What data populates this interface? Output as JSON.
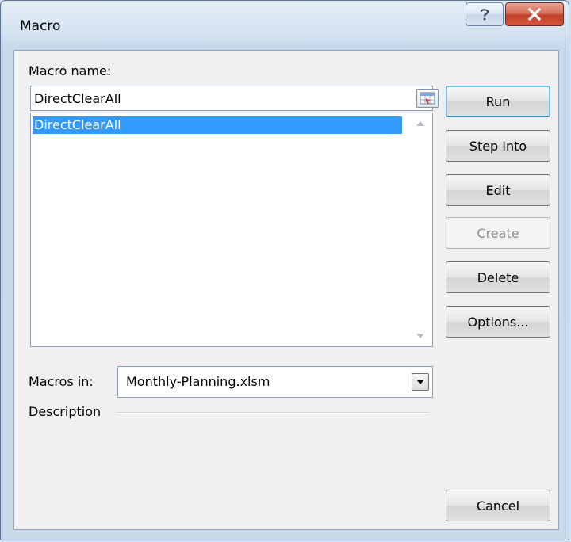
{
  "window": {
    "title": "Macro"
  },
  "titlebar": {
    "help_icon": "question-mark-icon",
    "close_icon": "close-x-icon",
    "close_color": "#c7432b"
  },
  "dialog": {
    "macro_name_label": "Macro name:",
    "macro_name_value": "DirectClearAll",
    "macro_list": [
      "DirectClearAll"
    ],
    "macros_in_label": "Macros in:",
    "macros_in_value": "Monthly-Planning.xlsm",
    "description_label": "Description",
    "selection_color": "#3399ff"
  },
  "buttons": {
    "run": "Run",
    "step_into": "Step Into",
    "edit": "Edit",
    "create": "Create",
    "delete": "Delete",
    "options": "Options...",
    "cancel": "Cancel"
  }
}
